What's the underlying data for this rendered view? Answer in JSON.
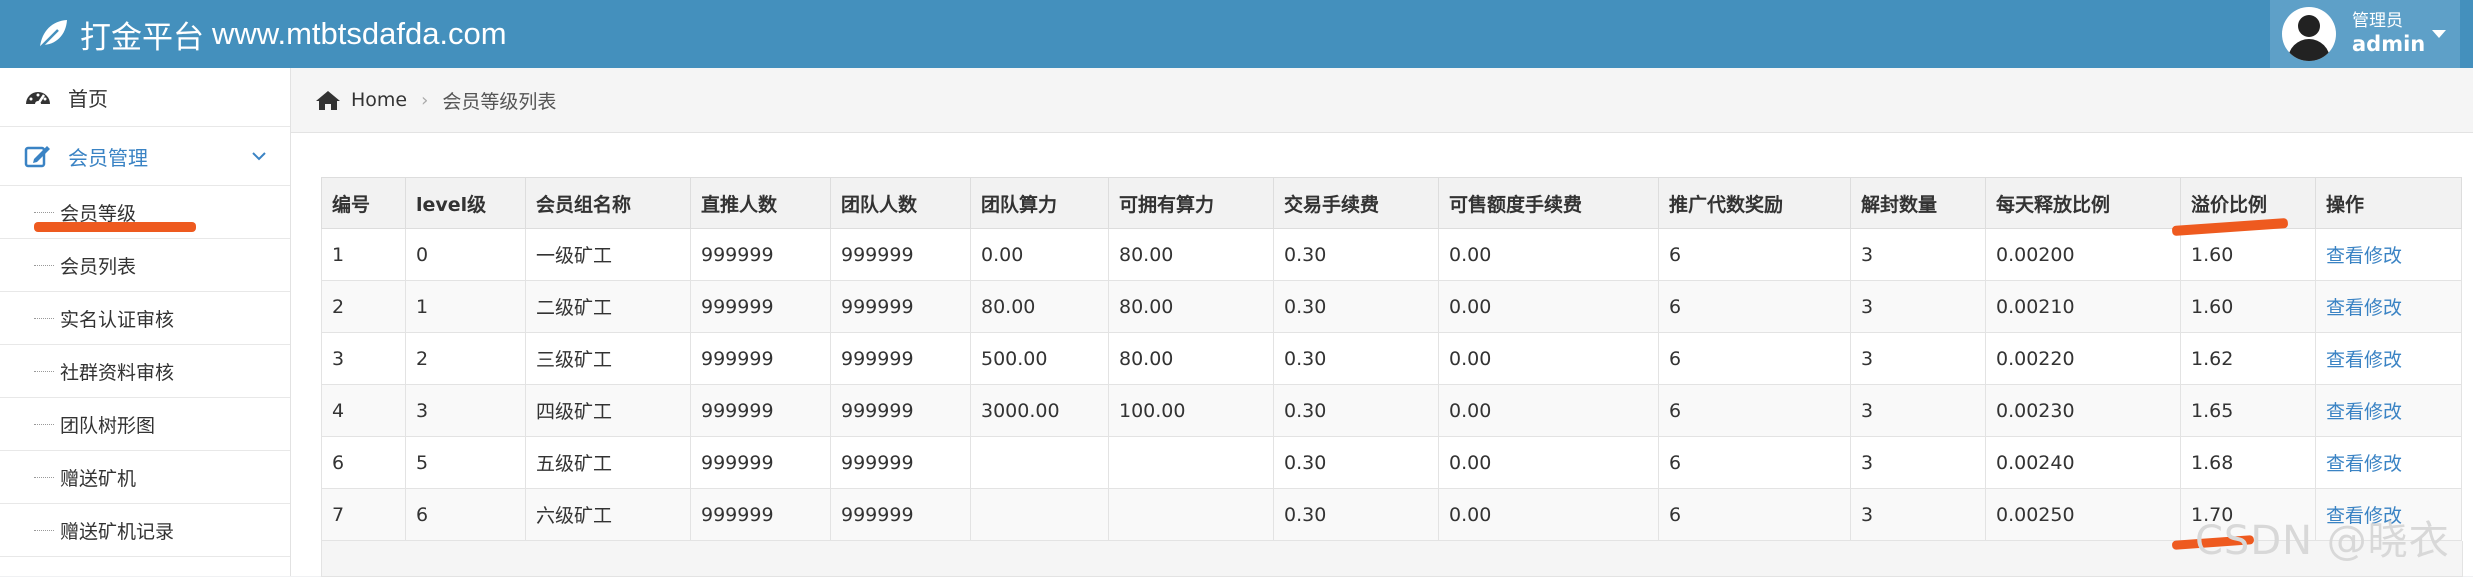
{
  "header": {
    "brand_title": "打金平台",
    "brand_site": "www.mtbtsdafda.com",
    "user_role": "管理员",
    "user_name": "admin"
  },
  "sidebar": {
    "items": [
      {
        "label": "首页",
        "icon": "dashboard-icon"
      },
      {
        "label": "会员管理",
        "icon": "edit-icon"
      }
    ],
    "submenu": [
      {
        "label": "会员等级"
      },
      {
        "label": "会员列表"
      },
      {
        "label": "实名认证审核"
      },
      {
        "label": "社群资料审核"
      },
      {
        "label": "团队树形图"
      },
      {
        "label": "赠送矿机"
      },
      {
        "label": "赠送矿机记录"
      }
    ]
  },
  "breadcrumb": {
    "home": "Home",
    "separator": "›",
    "current": "会员等级列表"
  },
  "table": {
    "columns": [
      "编号",
      "level级",
      "会员组名称",
      "直推人数",
      "团队人数",
      "团队算力",
      "可拥有算力",
      "交易手续费",
      "可售额度手续费",
      "推广代数奖励",
      "解封数量",
      "每天释放比例",
      "溢价比例",
      "操作"
    ],
    "rows": [
      [
        "1",
        "0",
        "一级矿工",
        "999999",
        "999999",
        "0.00",
        "80.00",
        "0.30",
        "0.00",
        "6",
        "3",
        "0.00200",
        "1.60",
        "查看修改"
      ],
      [
        "2",
        "1",
        "二级矿工",
        "999999",
        "999999",
        "80.00",
        "80.00",
        "0.30",
        "0.00",
        "6",
        "3",
        "0.00210",
        "1.60",
        "查看修改"
      ],
      [
        "3",
        "2",
        "三级矿工",
        "999999",
        "999999",
        "500.00",
        "80.00",
        "0.30",
        "0.00",
        "6",
        "3",
        "0.00220",
        "1.62",
        "查看修改"
      ],
      [
        "4",
        "3",
        "四级矿工",
        "999999",
        "999999",
        "3000.00",
        "100.00",
        "0.30",
        "0.00",
        "6",
        "3",
        "0.00230",
        "1.65",
        "查看修改"
      ],
      [
        "6",
        "5",
        "五级矿工",
        "999999",
        "999999",
        "",
        "",
        "0.30",
        "0.00",
        "6",
        "3",
        "0.00240",
        "1.68",
        "查看修改"
      ],
      [
        "7",
        "6",
        "六级矿工",
        "999999",
        "999999",
        "",
        "",
        "0.30",
        "0.00",
        "6",
        "3",
        "0.00250",
        "1.70",
        "查看修改"
      ]
    ]
  },
  "watermark": "CSDN @晓衣",
  "colors": {
    "header_bg": "#4490bd",
    "accent": "#3a83c4",
    "annotation": "#ee5a1f"
  }
}
